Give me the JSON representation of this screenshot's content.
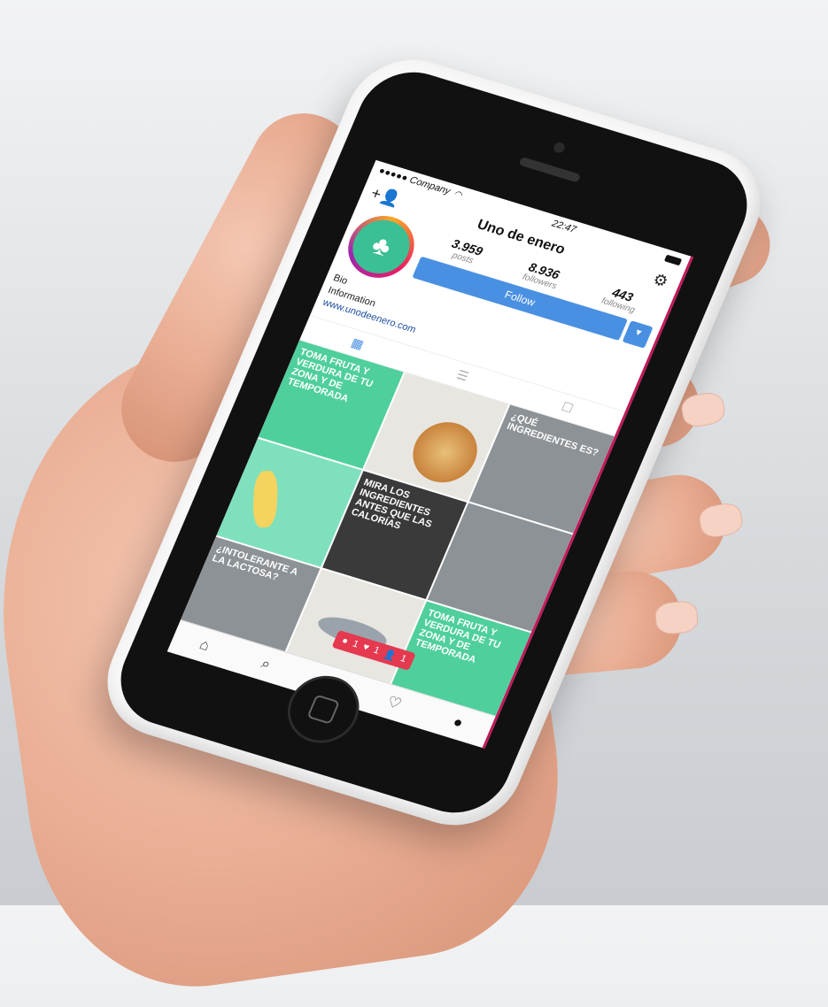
{
  "status_bar": {
    "carrier": "●●●●● Company",
    "wifi_icon": "wifi-icon",
    "time": "22:47",
    "battery_icon": "battery-icon"
  },
  "header": {
    "title": "Uno de enero",
    "add_user_icon": "add-user-icon",
    "settings_icon": "gear-icon"
  },
  "profile": {
    "avatar_icon": "pineapple-logo-icon",
    "stats": [
      {
        "value": "3.959",
        "label": "posts"
      },
      {
        "value": "8.936",
        "label": "followers"
      },
      {
        "value": "443",
        "label": "following"
      }
    ],
    "follow_label": "Follow",
    "follow_dropdown_icon": "chevron-down-icon",
    "bio_line1": "Bio",
    "bio_line2": "Information",
    "website": "www.unodeenero.com"
  },
  "view_tabs": [
    {
      "icon": "grid-icon",
      "active": true
    },
    {
      "icon": "list-icon",
      "active": false
    },
    {
      "icon": "tagged-icon",
      "active": false
    }
  ],
  "posts": [
    {
      "caption": "TOMA FRUTA Y VERDURA DE TU ZONA Y DE TEMPORADA",
      "style": "green"
    },
    {
      "caption": "",
      "style": "light",
      "image": "pizza"
    },
    {
      "caption": "¿QUÉ INGREDIENTES ES?",
      "style": "gray"
    },
    {
      "caption": "",
      "style": "mint",
      "image": "banana"
    },
    {
      "caption": "MIRA LOS INGREDIENTES ANTES QUE LAS CALORÍAS",
      "style": "dark"
    },
    {
      "caption": "",
      "style": "gray",
      "image": "flour"
    },
    {
      "caption": "¿INTOLERANTE A LA LACTOSA?",
      "style": "gray"
    },
    {
      "caption": "",
      "style": "light",
      "image": "fish"
    },
    {
      "caption": "TOMA FRUTA Y VERDURA DE TU ZONA Y DE TEMPORADA",
      "style": "green"
    }
  ],
  "notification": {
    "comments": "1",
    "likes": "1",
    "follows": "1"
  },
  "tabbar": [
    "home-icon",
    "search-icon",
    "add-post-icon",
    "activity-heart-icon",
    "profile-icon"
  ]
}
